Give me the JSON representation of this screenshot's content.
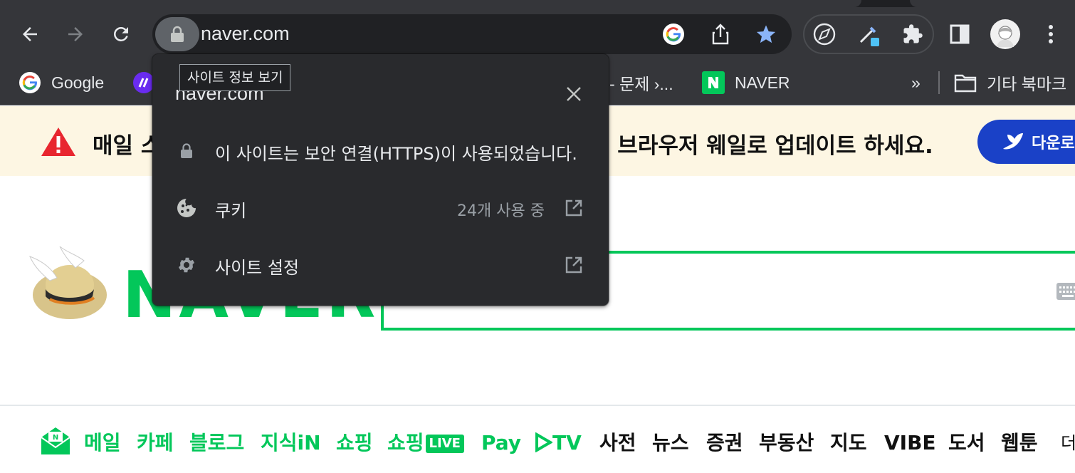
{
  "browser": {
    "url": "naver.com",
    "bookmarks": {
      "google": "Google",
      "partial": "- 문제 ›...",
      "naver": "NAVER",
      "overflow": "»",
      "other": "기타 북마크"
    }
  },
  "tooltip": {
    "text": "사이트 정보 보기"
  },
  "popup": {
    "title": "naver.com",
    "https_text": "이 사이트는 보안 연결(HTTPS)이 사용되었습니다.",
    "cookies_label": "쿠키",
    "cookies_count": "24개 사용 중",
    "site_settings_label": "사이트 설정"
  },
  "banner": {
    "text_left": "매일 스",
    "text_right": "신 브라우저 웨일로 업데이트 하세요.",
    "download_label": "다운로"
  },
  "naver": {
    "logo_text": "NAVER"
  },
  "services": {
    "mail": "메일",
    "cafe": "카페",
    "blog": "블로그",
    "kin": "지식iN",
    "shopping": "쇼핑",
    "shopping_live": "쇼핑",
    "live_badge": "LIVE",
    "pay": "Pay",
    "tv": "TV",
    "dict": "사전",
    "news": "뉴스",
    "stock": "증권",
    "realestate": "부동산",
    "map": "지도",
    "vibe": "VIBE",
    "books": "도서",
    "webtoon": "웹툰",
    "more": "더"
  },
  "colors": {
    "naver_green": "#03c75a",
    "banner_bg": "#fdf6e3",
    "whale_blue": "#1a41c7",
    "toolbar": "#35363a",
    "popup_bg": "#292a2d"
  }
}
